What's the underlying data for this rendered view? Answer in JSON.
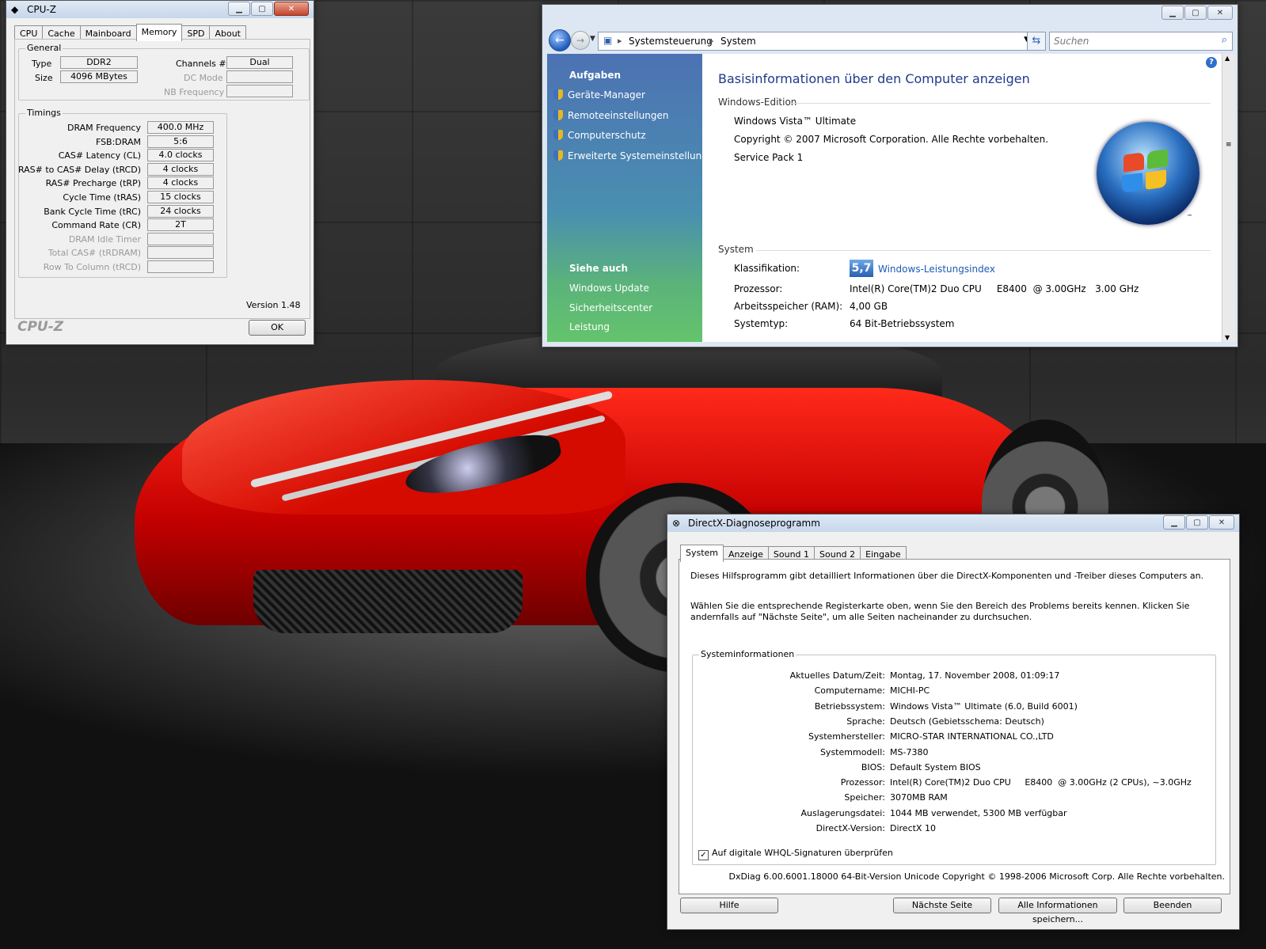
{
  "cpuz": {
    "title": "CPU-Z",
    "tabs": [
      "CPU",
      "Cache",
      "Mainboard",
      "Memory",
      "SPD",
      "About"
    ],
    "active_tab": "Memory",
    "general": {
      "legend": "General",
      "type_label": "Type",
      "type_value": "DDR2",
      "size_label": "Size",
      "size_value": "4096 MBytes",
      "channels_label": "Channels #",
      "channels_value": "Dual",
      "dcmode_label": "DC Mode",
      "dcmode_value": "",
      "nbfreq_label": "NB Frequency",
      "nbfreq_value": ""
    },
    "timings": {
      "legend": "Timings",
      "rows": [
        {
          "label": "DRAM Frequency",
          "value": "400.0 MHz",
          "dim": false
        },
        {
          "label": "FSB:DRAM",
          "value": "5:6",
          "dim": false
        },
        {
          "label": "CAS# Latency (CL)",
          "value": "4.0 clocks",
          "dim": false
        },
        {
          "label": "RAS# to CAS# Delay (tRCD)",
          "value": "4 clocks",
          "dim": false
        },
        {
          "label": "RAS# Precharge (tRP)",
          "value": "4 clocks",
          "dim": false
        },
        {
          "label": "Cycle Time (tRAS)",
          "value": "15 clocks",
          "dim": false
        },
        {
          "label": "Bank Cycle Time (tRC)",
          "value": "24 clocks",
          "dim": false
        },
        {
          "label": "Command Rate (CR)",
          "value": "2T",
          "dim": false
        },
        {
          "label": "DRAM Idle Timer",
          "value": "",
          "dim": true
        },
        {
          "label": "Total CAS# (tRDRAM)",
          "value": "",
          "dim": true
        },
        {
          "label": "Row To Column (tRCD)",
          "value": "",
          "dim": true
        }
      ]
    },
    "version": "Version 1.48",
    "brand": "CPU-Z",
    "ok_label": "OK"
  },
  "system": {
    "breadcrumb": [
      "Systemsteuerung",
      "System"
    ],
    "search_placeholder": "Suchen",
    "tasks_heading": "Aufgaben",
    "tasks": [
      "Geräte-Manager",
      "Remoteeinstellungen",
      "Computerschutz",
      "Erweiterte Systemeinstellungen"
    ],
    "see_also_heading": "Siehe auch",
    "see_also": [
      "Windows Update",
      "Sicherheitscenter",
      "Leistung"
    ],
    "page_title": "Basisinformationen über den Computer anzeigen",
    "edition_heading": "Windows-Edition",
    "edition_lines": [
      "Windows Vista™ Ultimate",
      "Copyright © 2007 Microsoft Corporation. Alle Rechte vorbehalten.",
      "Service Pack 1"
    ],
    "tm": "™",
    "system_heading": "System",
    "rating_label": "Klassifikation:",
    "rating_score": "5,7",
    "rating_link": "Windows-Leistungsindex",
    "rows": [
      {
        "label": "Prozessor:",
        "value": "Intel(R) Core(TM)2 Duo CPU     E8400  @ 3.00GHz   3.00 GHz"
      },
      {
        "label": "Arbeitsspeicher (RAM):",
        "value": "4,00 GB"
      },
      {
        "label": "Systemtyp:",
        "value": "64 Bit-Betriebssystem"
      }
    ]
  },
  "dxdiag": {
    "title": "DirectX-Diagnoseprogramm",
    "tabs": [
      "System",
      "Anzeige",
      "Sound 1",
      "Sound 2",
      "Eingabe"
    ],
    "active_tab": "System",
    "intro1": "Dieses Hilfsprogramm gibt detailliert Informationen über die DirectX-Komponenten und -Treiber dieses Computers an.",
    "intro2": "Wählen Sie die entsprechende Registerkarte oben, wenn Sie den Bereich des Problems bereits kennen. Klicken Sie andernfalls auf \"Nächste Seite\", um alle Seiten nacheinander zu durchsuchen.",
    "sysinfo_legend": "Systeminformationen",
    "rows": [
      {
        "label": "Aktuelles Datum/Zeit:",
        "value": "Montag, 17. November 2008, 01:09:17"
      },
      {
        "label": "Computername:",
        "value": "MICHI-PC"
      },
      {
        "label": "Betriebssystem:",
        "value": "Windows Vista™ Ultimate (6.0, Build 6001)"
      },
      {
        "label": "Sprache:",
        "value": "Deutsch (Gebietsschema: Deutsch)"
      },
      {
        "label": "Systemhersteller:",
        "value": "MICRO-STAR INTERNATIONAL CO.,LTD"
      },
      {
        "label": "Systemmodell:",
        "value": "MS-7380"
      },
      {
        "label": "BIOS:",
        "value": "Default System BIOS"
      },
      {
        "label": "Prozessor:",
        "value": "Intel(R) Core(TM)2 Duo CPU     E8400  @ 3.00GHz (2 CPUs), ~3.0GHz"
      },
      {
        "label": "Speicher:",
        "value": "3070MB RAM"
      },
      {
        "label": "Auslagerungsdatei:",
        "value": "1044 MB verwendet, 5300 MB verfügbar"
      },
      {
        "label": "DirectX-Version:",
        "value": "DirectX 10"
      }
    ],
    "whql_label": "Auf digitale WHQL-Signaturen überprüfen",
    "whql_checked": true,
    "footer": "DxDiag 6.00.6001.18000 64-Bit-Version Unicode Copyright © 1998-2006 Microsoft Corp. Alle Rechte vorbehalten.",
    "buttons": {
      "help": "Hilfe",
      "next": "Nächste Seite",
      "save": "Alle Informationen speichern...",
      "exit": "Beenden"
    }
  }
}
